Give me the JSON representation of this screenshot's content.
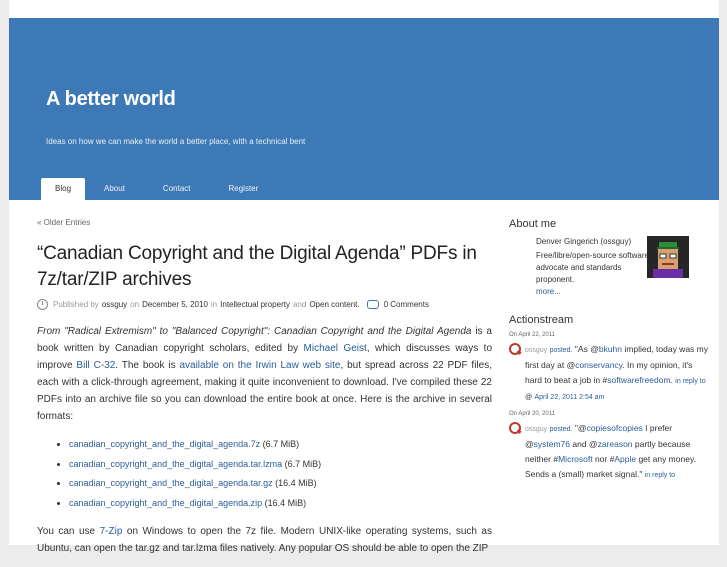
{
  "site": {
    "title": "A better world",
    "description": "Ideas on how we can make the world a better place, with a technical bent"
  },
  "nav": {
    "items": [
      "Blog",
      "About",
      "Contact",
      "Register"
    ],
    "active": "Blog"
  },
  "post": {
    "older_entries": "« Older Entries",
    "title": "“Canadian Copyright and the Digital Agenda” PDFs in 7z/tar/ZIP archives",
    "meta": {
      "published_by": "Published by",
      "author": "ossguy",
      "on": "on",
      "date": "December 5, 2010",
      "in": "in",
      "category1": "Intellectual property",
      "and": "and",
      "category2": "Open content",
      "period": ".",
      "comments": "0 Comments"
    },
    "p1": {
      "book_title": "From \"Radical Extremism\" to \"Balanced Copyright\": Canadian Copyright and the Digital Agenda",
      "t1": " is a book written by Canadian copyright scholars, edited by ",
      "editor": "Michael Geist",
      "t2": ", which discusses ways to improve ",
      "bill": "Bill C-32",
      "t3": ". The book is ",
      "link": "available on the Irwin Law web site",
      "t4": ", but spread across 22 PDF files, each with a click-through agreement, making it quite inconvenient to download. I've compiled these 22 PDFs into an archive file so you can download the entire book at once. Here is the archive in several formats:"
    },
    "files": [
      {
        "name": "canadian_copyright_and_the_digital_agenda.7z",
        "size": " (6.7 MiB)"
      },
      {
        "name": "canadian_copyright_and_the_digital_agenda.tar.lzma",
        "size": " (6.7 MiB)"
      },
      {
        "name": "canadian_copyright_and_the_digital_agenda.tar.gz",
        "size": " (16.4 MiB)"
      },
      {
        "name": "canadian_copyright_and_the_digital_agenda.zip",
        "size": " (16.4 MiB)"
      }
    ],
    "p2": {
      "t1": "You can use ",
      "link": "7-Zip",
      "t2": " on Windows to open the 7z file. Modern UNIX-like operating systems, such as Ubuntu, can open the tar.gz and tar.lzma files natively. Any popular OS should be able to open the ZIP"
    }
  },
  "sidebar": {
    "about": {
      "title": "About me",
      "name": "Denver Gingerich (ossguy)",
      "bio": "Free/libre/open-source software advocate and standards proponent.",
      "more": "more..."
    },
    "actionstream": {
      "title": "Actionstream",
      "items": [
        {
          "date": "On April 22, 2011",
          "user": "ossguy",
          "action": "posted.",
          "t1": "\"As @",
          "mention1": "bkuhn",
          "t2": " implied, today was my first day at @",
          "mention2": "conservancy",
          "t3": ". In my opinion, it's hard to beat a job in #",
          "hashtag": "softwarefreedom",
          "t4": ".",
          "reply": "in reply to",
          "at": "@",
          "time": "April 22, 2011 2:54 am"
        },
        {
          "date": "On April 20, 2011",
          "user": "ossguy",
          "action": "posted.",
          "t1": "\"@",
          "mention1": "copiesofcopies",
          "t2": " I prefer @",
          "mention2": "system76",
          "t3": " and @",
          "mention3": "zareason",
          "t4": " partly because neither #",
          "hashtag1": "Microsoft",
          "t5": " nor #",
          "hashtag2": "Apple",
          "t6": " get any money. Sends a (small) market signal.\"",
          "reply": "in reply to"
        }
      ]
    }
  },
  "colors": {
    "header_bg": "#3d79b6",
    "link": "#2a5d9a",
    "icon_red": "#c0392b"
  }
}
